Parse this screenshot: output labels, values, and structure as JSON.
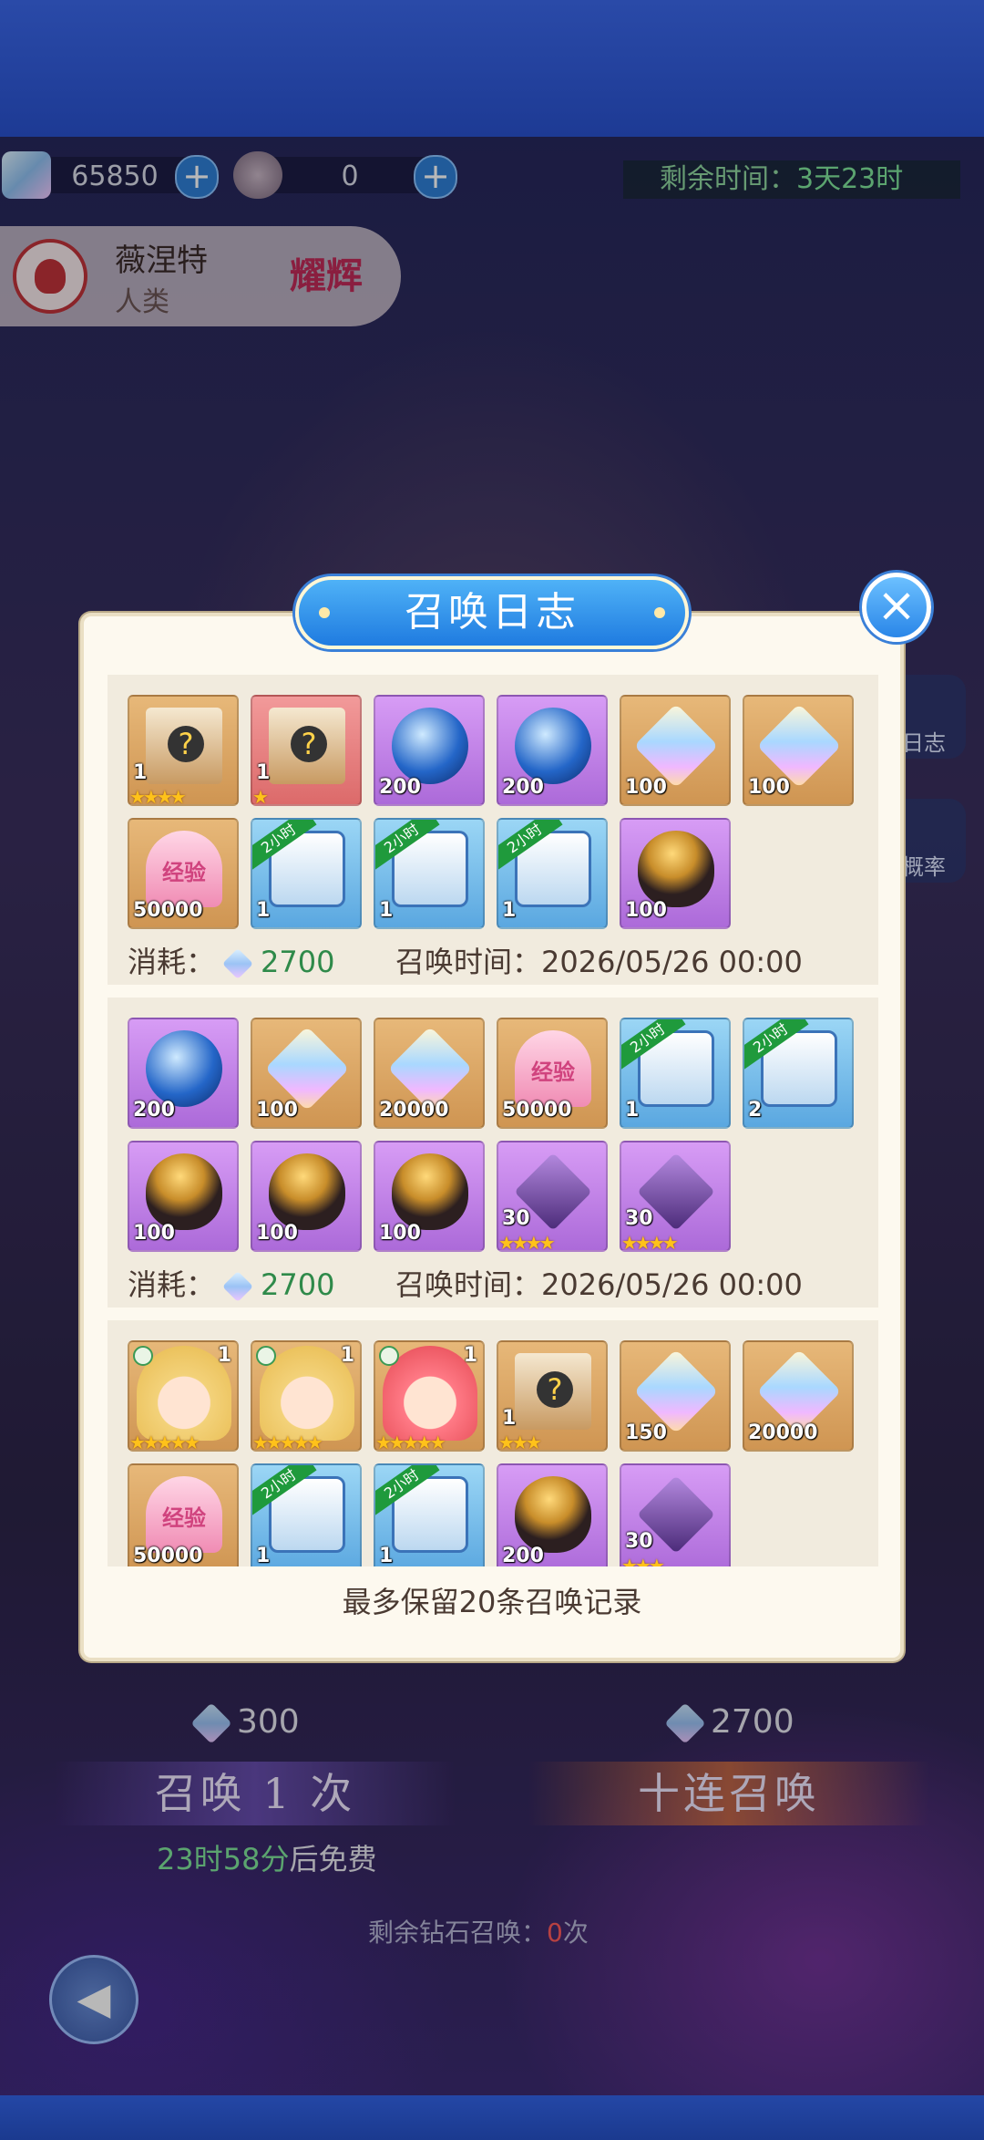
{
  "resources": [
    {
      "icon": "diamond-icon",
      "value": "65850"
    },
    {
      "icon": "music-note-ticket-icon",
      "value": "0"
    }
  ],
  "timer": {
    "label": "剩余时间：",
    "value": "3天23时"
  },
  "hero": {
    "name": "薇涅特",
    "race": "人类",
    "rank": "耀辉"
  },
  "side_buttons": [
    {
      "icon": "log-icon",
      "label": "日志"
    },
    {
      "icon": "dice-icon",
      "label": "概率"
    }
  ],
  "popup": {
    "title": "召唤日志",
    "footer": "最多保留20条召唤记录",
    "records": [
      {
        "cost_label": "消耗：",
        "cost": "2700",
        "time_label": "召唤时间：",
        "time": "2026/05/26 00:00",
        "items": [
          {
            "name": "mystery-box",
            "bg": "tan",
            "art": "box",
            "qty": "1",
            "stars": 4
          },
          {
            "name": "mystery-box",
            "bg": "red",
            "art": "box",
            "qty": "1",
            "stars": 1
          },
          {
            "name": "blue-orb",
            "bg": "purple",
            "art": "orb",
            "qty": "200"
          },
          {
            "name": "blue-orb",
            "bg": "purple",
            "art": "orb",
            "qty": "200"
          },
          {
            "name": "rainbow-crystal",
            "bg": "tan",
            "art": "gem",
            "qty": "100"
          },
          {
            "name": "rainbow-crystal",
            "bg": "tan",
            "art": "gem",
            "qty": "100"
          },
          {
            "name": "exp-heart",
            "bg": "tan",
            "art": "heart",
            "qty": "50000"
          },
          {
            "name": "timed-chest",
            "bg": "blue",
            "art": "chest",
            "qty": "1",
            "ribbon": "2小时"
          },
          {
            "name": "timed-chest",
            "bg": "blue",
            "art": "chest",
            "qty": "1",
            "ribbon": "2小时"
          },
          {
            "name": "timed-chest",
            "bg": "blue",
            "art": "chest",
            "qty": "1",
            "ribbon": "2小时"
          },
          {
            "name": "golden-egg",
            "bg": "purple",
            "art": "egg",
            "qty": "100"
          }
        ]
      },
      {
        "cost_label": "消耗：",
        "cost": "2700",
        "time_label": "召唤时间：",
        "time": "2026/05/26 00:00",
        "items": [
          {
            "name": "blue-orb",
            "bg": "purple",
            "art": "orb",
            "qty": "200"
          },
          {
            "name": "rainbow-crystal",
            "bg": "tan",
            "art": "gem",
            "qty": "100"
          },
          {
            "name": "rainbow-crystal",
            "bg": "tan",
            "art": "gem",
            "qty": "20000"
          },
          {
            "name": "exp-heart",
            "bg": "tan",
            "art": "heart",
            "qty": "50000"
          },
          {
            "name": "timed-chest",
            "bg": "blue",
            "art": "chest",
            "qty": "1",
            "ribbon": "2小时"
          },
          {
            "name": "timed-chest",
            "bg": "blue",
            "art": "chest",
            "qty": "2",
            "ribbon": "2小时"
          },
          {
            "name": "golden-egg",
            "bg": "purple",
            "art": "egg",
            "qty": "100"
          },
          {
            "name": "golden-egg",
            "bg": "purple",
            "art": "egg",
            "qty": "100"
          },
          {
            "name": "golden-egg",
            "bg": "purple",
            "art": "egg",
            "qty": "100"
          },
          {
            "name": "purple-crystal",
            "bg": "purple",
            "art": "crystal",
            "qty": "30",
            "stars": 4
          },
          {
            "name": "purple-crystal",
            "bg": "purple",
            "art": "crystal",
            "qty": "30",
            "stars": 4
          }
        ]
      },
      {
        "items": [
          {
            "name": "hero-card-blonde",
            "bg": "tan",
            "art": "face blonde",
            "corner": "1",
            "stars": 5,
            "badge": true
          },
          {
            "name": "hero-card-blonde",
            "bg": "tan",
            "art": "face blonde",
            "corner": "1",
            "stars": 5,
            "badge": true
          },
          {
            "name": "hero-card-pink",
            "bg": "tan",
            "art": "face pink",
            "corner": "1",
            "stars": 5,
            "badge": true
          },
          {
            "name": "mystery-box",
            "bg": "tan",
            "art": "box",
            "qty": "1",
            "stars": 3
          },
          {
            "name": "rainbow-crystal",
            "bg": "tan",
            "art": "gem",
            "qty": "150"
          },
          {
            "name": "rainbow-crystal",
            "bg": "tan",
            "art": "gem",
            "qty": "20000"
          },
          {
            "name": "exp-heart",
            "bg": "tan",
            "art": "heart",
            "qty": "50000"
          },
          {
            "name": "timed-chest",
            "bg": "blue",
            "art": "chest",
            "qty": "1",
            "ribbon": "2小时"
          },
          {
            "name": "timed-chest",
            "bg": "blue",
            "art": "chest",
            "qty": "1",
            "ribbon": "2小时"
          },
          {
            "name": "golden-egg",
            "bg": "purple",
            "art": "egg",
            "qty": "200"
          },
          {
            "name": "purple-crystal",
            "bg": "purple",
            "art": "crystal",
            "qty": "30",
            "stars": 3
          }
        ]
      }
    ]
  },
  "summon": {
    "single_cost": "300",
    "single_label": "召唤 1 次",
    "ten_cost": "2700",
    "ten_label": "十连召唤",
    "free_time": "23时58分",
    "free_suffix": "后免费",
    "remaining_label": "剩余钻石召唤：",
    "remaining_count": "0",
    "remaining_unit": "次"
  },
  "colors": {
    "accent_blue": "#2a86e8",
    "panel": "#fdf9ef",
    "cost_green": "#2f8a4a"
  }
}
